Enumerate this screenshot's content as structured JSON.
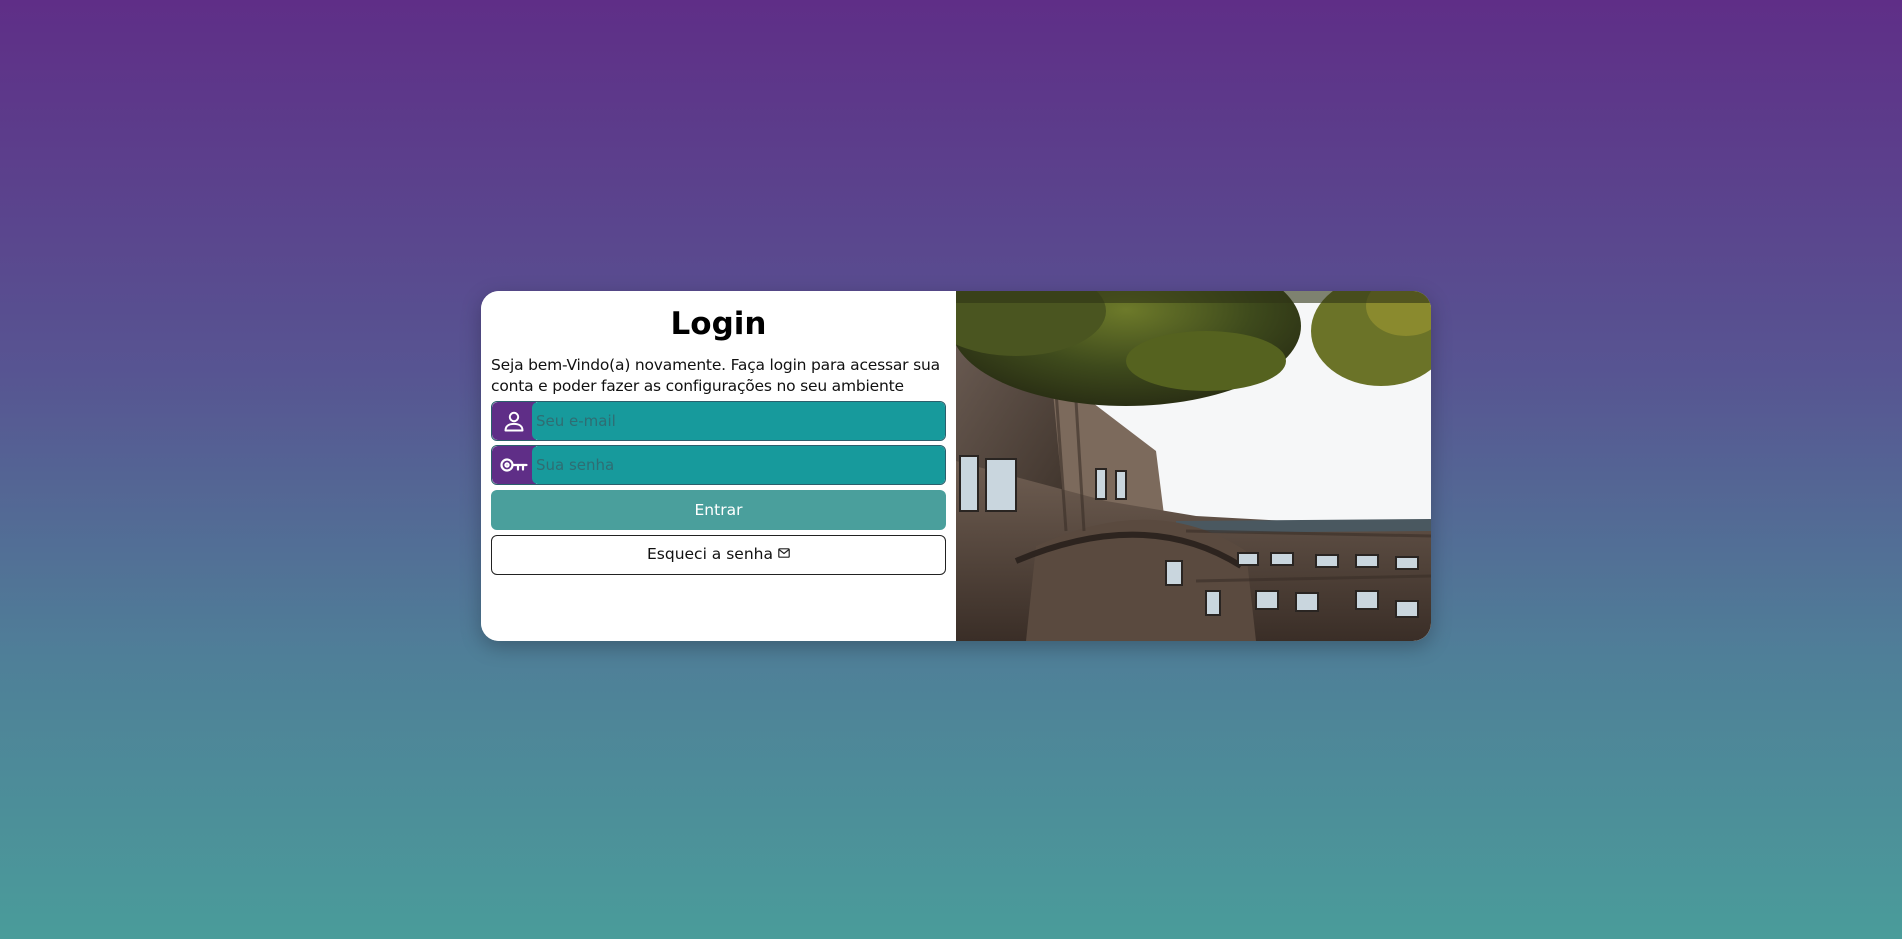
{
  "login": {
    "title": "Login",
    "subtitle": "Seja bem-Vindo(a) novamente. Faça login para acessar sua conta e poder fazer as configurações no seu ambiente",
    "email_placeholder": "Seu e-mail",
    "password_placeholder": "Sua senha",
    "submit_label": "Entrar",
    "forgot_label": "Esqueci a senha"
  },
  "icons": {
    "user": "user-icon",
    "key": "key-icon",
    "mail": "mail-icon"
  },
  "colors": {
    "accent_purple": "#5f2e87",
    "input_teal": "#179a9c",
    "button_teal": "#4a9f9c",
    "background_top": "#5f2e87",
    "background_bottom": "#4a9c9a"
  }
}
